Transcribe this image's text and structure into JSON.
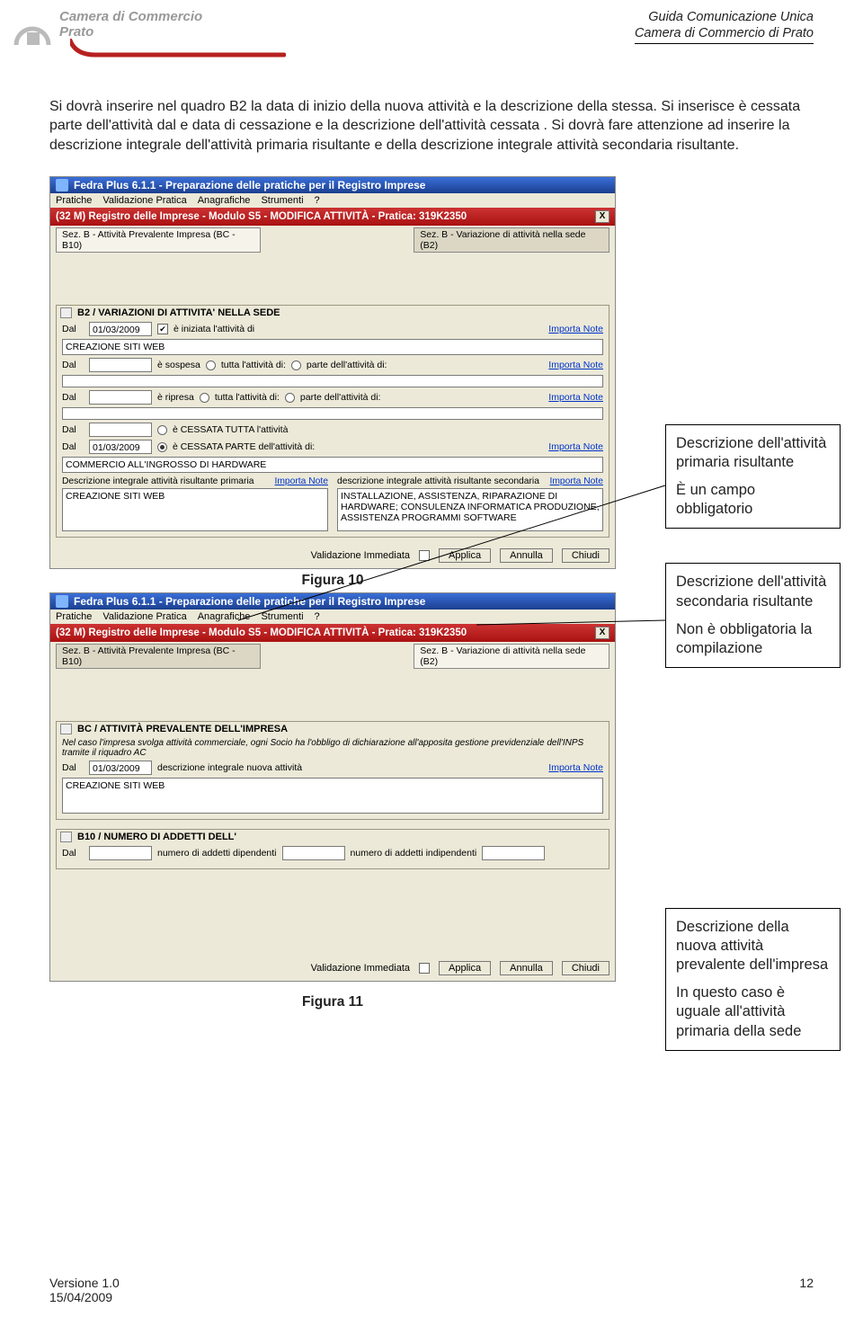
{
  "header": {
    "org_line1": "Camera di Commercio",
    "org_line2": "Prato",
    "doc_line1": "Guida Comunicazione Unica",
    "doc_line2": "Camera di Commercio di Prato"
  },
  "body_text": "Si dovrà inserire nel quadro B2 la data di inizio della nuova attività e la descrizione della stessa. Si inserisce è cessata parte dell'attività dal e data di cessazione e la descrizione dell'attività cessata . Si dovrà fare attenzione ad inserire la descrizione integrale dell'attività primaria risultante e della descrizione integrale attività secondaria risultante.",
  "shot1": {
    "title": "Fedra Plus 6.1.1 - Preparazione delle pratiche per il Registro Imprese",
    "menu": [
      "Pratiche",
      "Validazione Pratica",
      "Anagrafiche",
      "Strumenti",
      "?"
    ],
    "modbar": "(32 M) Registro delle Imprese - Modulo S5 - MODIFICA ATTIVITÀ - Pratica: 319K2350",
    "tab_a": "Sez. B - Attività Prevalente Impresa (BC - B10)",
    "tab_b": "Sez. B - Variazione di attività nella sede (B2)",
    "group_title": "B2 / VARIAZIONI DI ATTIVITA' NELLA SEDE",
    "row1": {
      "lbl": "Dal",
      "date": "01/03/2009",
      "chk": "✔",
      "txt": "è iniziata l'attività di",
      "link": "Importa Note"
    },
    "creazione": "CREAZIONE SITI WEB",
    "row2": {
      "lbl": "Dal",
      "r1": "è sospesa",
      "r2": "tutta l'attività di:",
      "r3": "parte dell'attività di:",
      "link": "Importa Note"
    },
    "row3": {
      "lbl": "Dal",
      "r1": "è ripresa",
      "r2": "tutta l'attività di:",
      "r3": "parte dell'attività di:",
      "link": "Importa Note"
    },
    "row4a": {
      "lbl": "Dal",
      "txt": "è CESSATA TUTTA l'attività"
    },
    "row4b": {
      "lbl": "Dal",
      "date": "01/03/2009",
      "txt": "è CESSATA PARTE dell'attività di:",
      "link": "Importa Note"
    },
    "commercio": "COMMERCIO ALL'INGROSSO DI HARDWARE",
    "col_left_h": "Descrizione integrale attività risultante primaria",
    "col_right_h": "descrizione integrale attività risultante secondaria",
    "col_left_link": "Importa Note",
    "col_right_link": "Importa Note",
    "col_left_val": "CREAZIONE SITI WEB",
    "col_right_val": "INSTALLAZIONE, ASSISTENZA, RIPARAZIONE DI HARDWARE; CONSULENZA INFORMATICA PRODUZIONE, ASSISTENZA PROGRAMMI SOFTWARE",
    "foot": {
      "valid": "Validazione Immediata",
      "apply": "Applica",
      "cancel": "Annulla",
      "close": "Chiudi"
    }
  },
  "fig10": "Figura 10",
  "callout1_a": "Descrizione dell'attività primaria risultante",
  "callout1_b": "È un campo obbligatorio",
  "callout2_a": "Descrizione dell'attività secondaria risultante",
  "callout2_b": "Non è obbligatoria la compilazione",
  "shot2": {
    "title": "Fedra Plus 6.1.1 - Preparazione delle pratiche per il Registro Imprese",
    "menu": [
      "Pratiche",
      "Validazione Pratica",
      "Anagrafiche",
      "Strumenti",
      "?"
    ],
    "modbar": "(32 M) Registro delle Imprese - Modulo S5 - MODIFICA ATTIVITÀ - Pratica: 319K2350",
    "tab_a": "Sez. B - Attività Prevalente Impresa (BC - B10)",
    "tab_b": "Sez. B - Variazione di attività nella sede (B2)",
    "group_title": "BC / ATTIVITÀ PREVALENTE DELL'IMPRESA",
    "note": "Nel caso l'impresa svolga attività commerciale, ogni Socio ha l'obbligo di dichiarazione all'apposita gestione previdenziale dell'INPS tramite il riquadro AC",
    "row1": {
      "lbl": "Dal",
      "date": "01/03/2009",
      "txt": "descrizione integrale nuova attività",
      "link": "Importa Note"
    },
    "val": "CREAZIONE SITI WEB",
    "group2_title": "B10 / NUMERO DI ADDETTI DELL'",
    "row2": {
      "lbl": "Dal",
      "f1": "numero di addetti dipendenti",
      "f2": "numero di addetti indipendenti"
    },
    "foot": {
      "valid": "Validazione Immediata",
      "apply": "Applica",
      "cancel": "Annulla",
      "close": "Chiudi"
    }
  },
  "callout3_a": "Descrizione della nuova attività prevalente dell'impresa",
  "callout3_b": "In questo caso è uguale all'attività primaria della sede",
  "fig11": "Figura 11",
  "footer": {
    "ver": "Versione 1.0",
    "date": "15/04/2009",
    "page": "12"
  }
}
